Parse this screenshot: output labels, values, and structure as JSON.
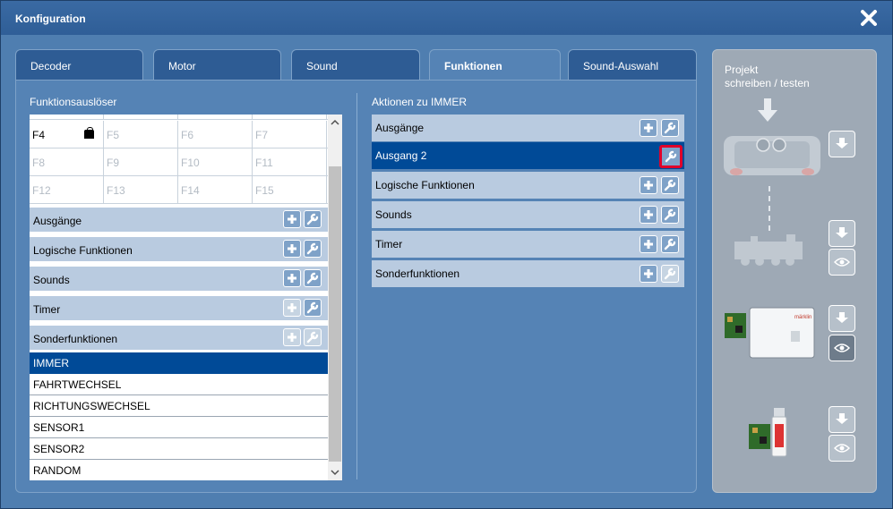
{
  "window": {
    "title": "Konfiguration"
  },
  "tabs": [
    {
      "label": "Decoder"
    },
    {
      "label": "Motor"
    },
    {
      "label": "Sound"
    },
    {
      "label": "Funktionen"
    },
    {
      "label": "Sound-Auswahl"
    }
  ],
  "left": {
    "heading": "Funktionsauslöser",
    "grid": [
      [
        "F4",
        "F5",
        "F6",
        "F7"
      ],
      [
        "F8",
        "F9",
        "F10",
        "F11"
      ],
      [
        "F12",
        "F13",
        "F14",
        "F15"
      ]
    ],
    "categories": [
      {
        "label": "Ausgänge"
      },
      {
        "label": "Logische Funktionen"
      },
      {
        "label": "Sounds"
      },
      {
        "label": "Timer"
      },
      {
        "label": "Sonderfunktionen"
      }
    ],
    "triggers": [
      {
        "label": "IMMER"
      },
      {
        "label": "FAHRTWECHSEL"
      },
      {
        "label": "RICHTUNGSWECHSEL"
      },
      {
        "label": "SENSOR1"
      },
      {
        "label": "SENSOR2"
      },
      {
        "label": "RANDOM"
      }
    ]
  },
  "right": {
    "heading": "Aktionen zu IMMER",
    "rows": [
      {
        "label": "Ausgänge"
      },
      {
        "label": "Ausgang 2"
      },
      {
        "label": "Logische Funktionen"
      },
      {
        "label": "Sounds"
      },
      {
        "label": "Timer"
      },
      {
        "label": "Sonderfunktionen"
      }
    ]
  },
  "project": {
    "title_line1": "Projekt",
    "title_line2": "schreiben / testen",
    "device_logo": "märklin"
  },
  "colors": {
    "selected_row": "#004a97",
    "category_row": "#b9cbe0",
    "highlight_border": "#e0002a"
  }
}
